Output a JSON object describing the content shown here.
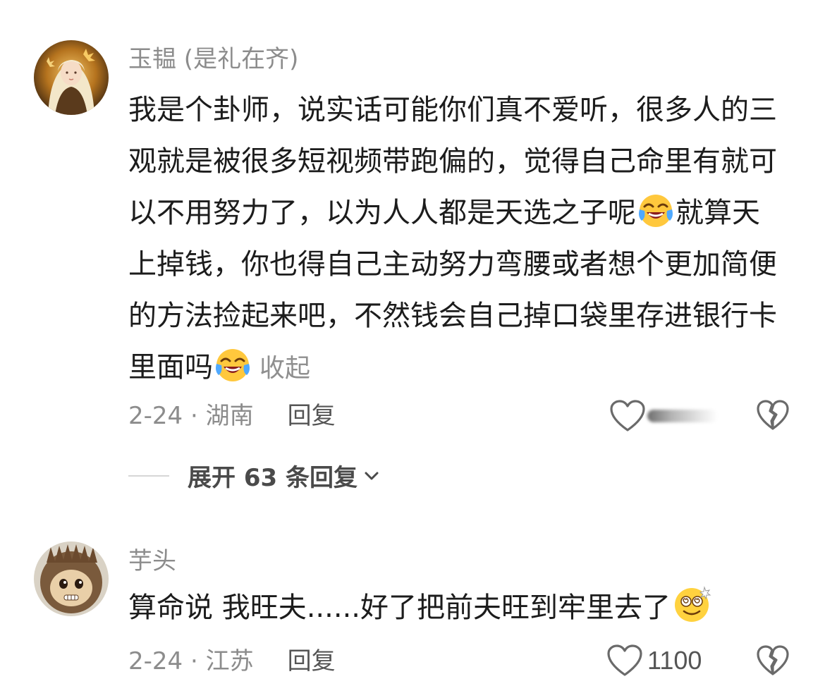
{
  "comments": [
    {
      "username": "玉韫 (是礼在齐)",
      "text_part1": "我是个卦师，说实话可能你们真不爱听，很多人的三观就是被很多短视频带跑偏的，觉得自己命里有就可以不用努力了，以为人人都是天选之子呢",
      "emoji1": "laughing-crying-emoji",
      "text_part2": "就算天上掉钱，你也得自己主动努力弯腰或者想个更加简便的方法捡起来吧，不然钱会自己掉口袋里存进银行卡里面吗",
      "emoji2": "laughing-crying-emoji",
      "collapse": "收起",
      "date_location": "2-24 · 湖南",
      "reply": "回复",
      "like_count": "",
      "expand_replies": "展开 63 条回复"
    },
    {
      "username": "芋头",
      "text_part1": "算命说 我旺夫......好了把前夫旺到牢里去了",
      "emoji1": "dizzy-smile-emoji",
      "date_location": "2-24 · 江苏",
      "reply": "回复",
      "like_count": "1100"
    }
  ],
  "colors": {
    "text": "#1c1c1c",
    "meta": "#8c8c8c",
    "icon_stroke": "#6a6a6a"
  }
}
